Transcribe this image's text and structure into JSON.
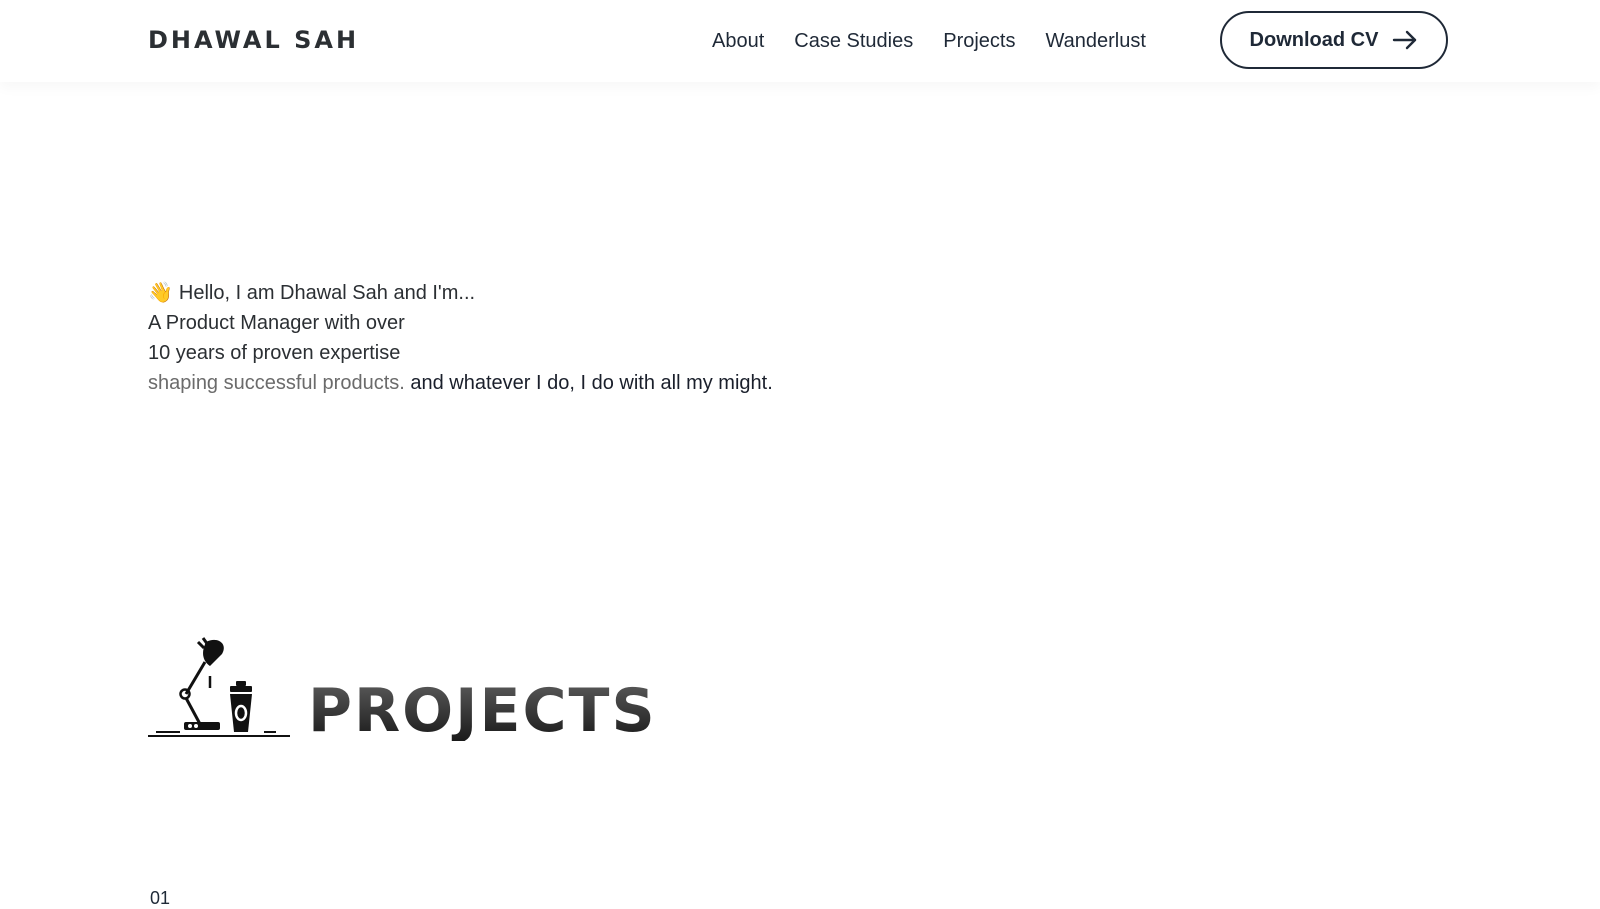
{
  "header": {
    "brand": "DHAWAL SAH",
    "nav": [
      "About",
      "Case Studies",
      "Projects",
      "Wanderlust"
    ],
    "cta_label": "Download CV",
    "cta_icon": "arrow-right-icon"
  },
  "hero": {
    "wave_icon": "👋",
    "greeting": "Hello, I am Dhawal Sah and I'm...",
    "line1": "A Product Manager with over",
    "line2": "10 years of proven expertise",
    "line3_muted": "shaping successful products.",
    "line3_strong": "and whatever I do, I do with all my might."
  },
  "projects": {
    "icon": "desk-lamp-coffee-icon",
    "title": "PROJECTS",
    "first_number": "01"
  },
  "colors": {
    "text": "#1f2937",
    "muted": "#6b6b6b",
    "background": "#ffffff"
  }
}
